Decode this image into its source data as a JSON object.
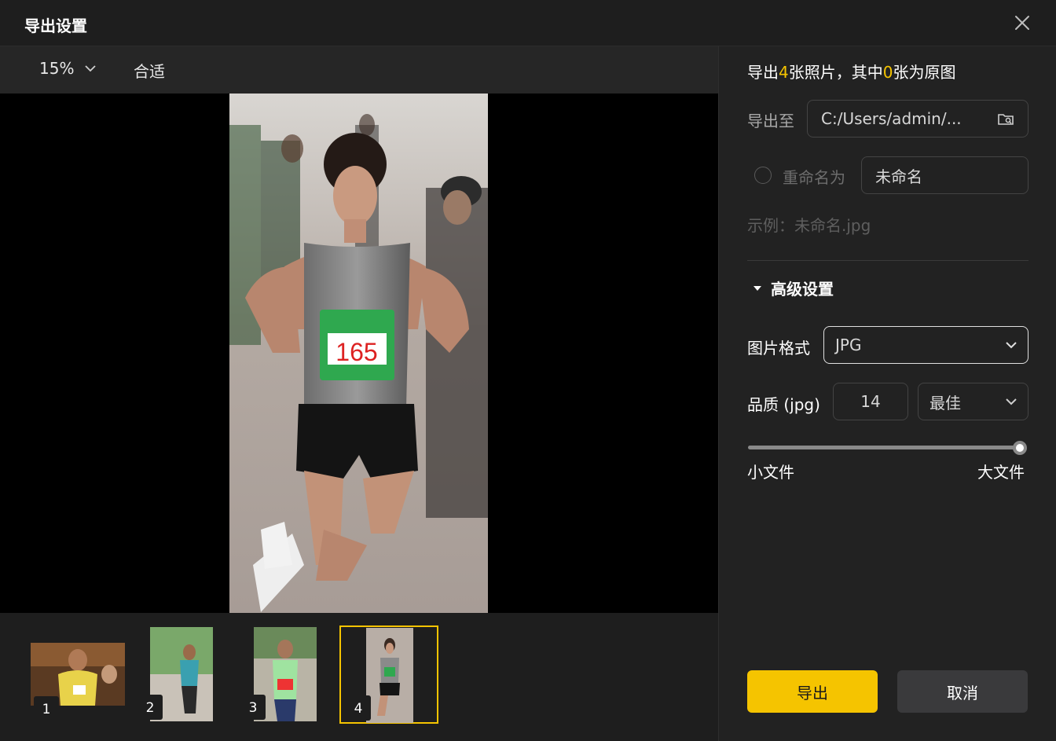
{
  "dialog": {
    "title": "导出设置"
  },
  "toolbar": {
    "zoom": "15%",
    "fit": "合适"
  },
  "thumbnails": [
    {
      "num": "1"
    },
    {
      "num": "2"
    },
    {
      "num": "3"
    },
    {
      "num": "4"
    }
  ],
  "photo": {
    "bib_number": "165"
  },
  "summary": {
    "prefix": "导出",
    "count": "4",
    "middle": "张照片，其中",
    "original": "0",
    "suffix": "张为原图"
  },
  "export_to": {
    "label": "导出至",
    "path": "C:/Users/admin/..."
  },
  "rename": {
    "label": "重命名为",
    "value": "未命名"
  },
  "example": {
    "text": "示例：未命名.jpg"
  },
  "advanced": {
    "label": "高级设置"
  },
  "format": {
    "label": "图片格式",
    "value": "JPG"
  },
  "quality": {
    "label": "品质 (jpg)",
    "value": "14",
    "preset": "最佳",
    "level": 1.0
  },
  "slider": {
    "min_label": "小文件",
    "max_label": "大文件"
  },
  "buttons": {
    "export": "导出",
    "cancel": "取消"
  },
  "colors": {
    "accent": "#f5c400",
    "background": "#1e1e1e",
    "panel": "#222222"
  }
}
